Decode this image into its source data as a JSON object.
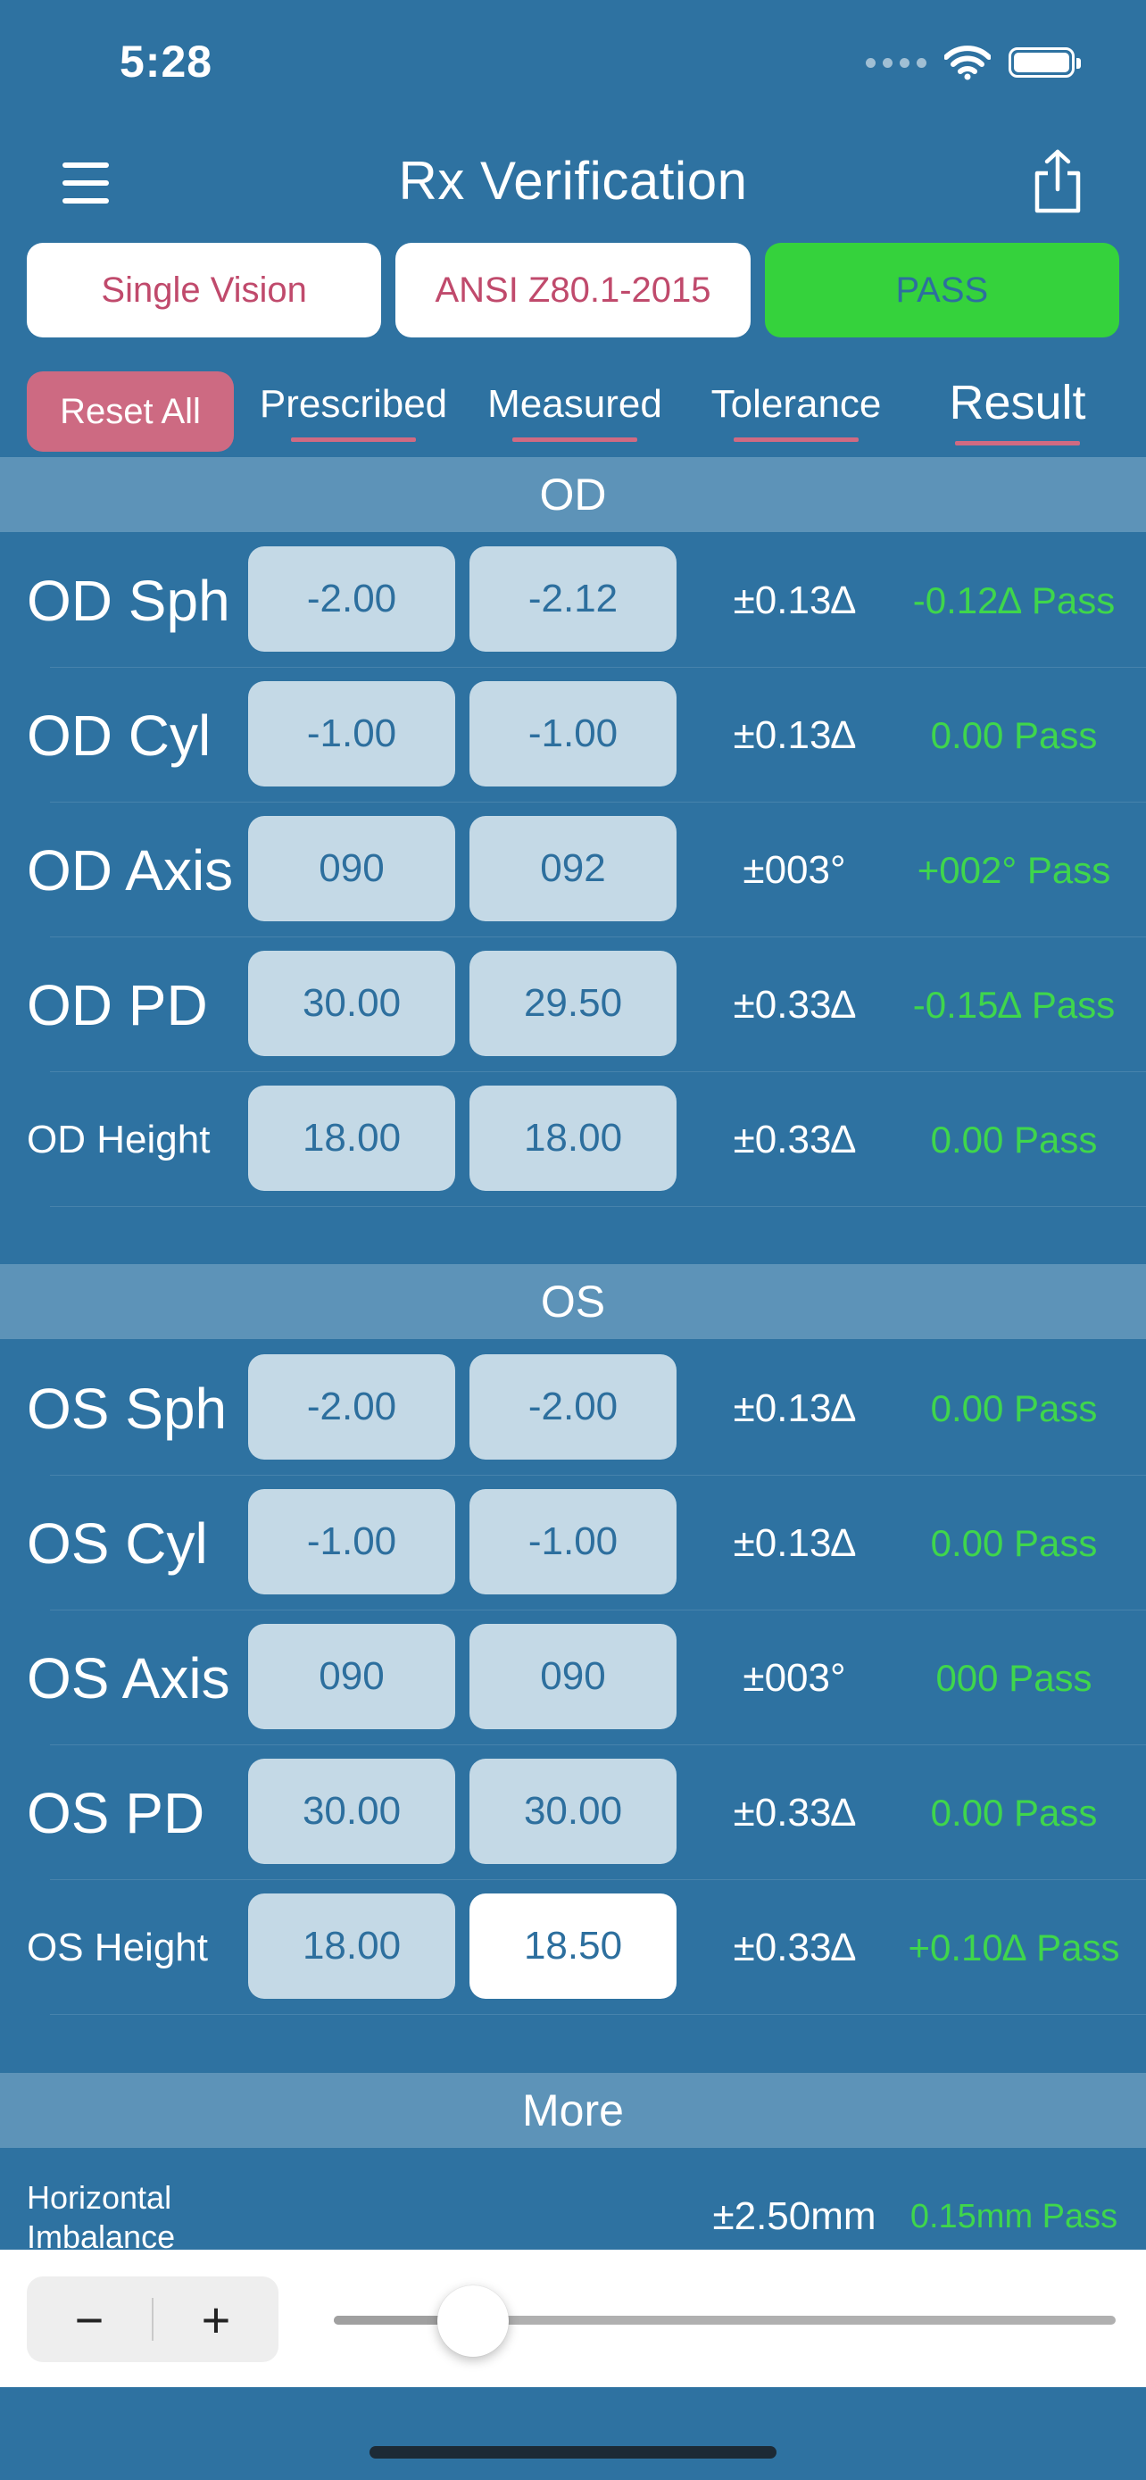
{
  "status": {
    "time": "5:28"
  },
  "nav": {
    "title": "Rx Verification"
  },
  "segments": {
    "lens_type": "Single Vision",
    "standard": "ANSI Z80.1-2015",
    "status": "PASS"
  },
  "headers": {
    "reset": "Reset All",
    "prescribed": "Prescribed",
    "measured": "Measured",
    "tolerance": "Tolerance",
    "result": "Result"
  },
  "od": {
    "title": "OD",
    "rows": [
      {
        "label": "OD Sph",
        "prescribed": "-2.00",
        "measured": "-2.12",
        "tolerance": "±0.13∆",
        "result": "-0.12∆ Pass"
      },
      {
        "label": "OD Cyl",
        "prescribed": "-1.00",
        "measured": "-1.00",
        "tolerance": "±0.13∆",
        "result": "0.00 Pass"
      },
      {
        "label": "OD Axis",
        "prescribed": "090",
        "measured": "092",
        "tolerance": "±003°",
        "result": "+002° Pass"
      },
      {
        "label": "OD PD",
        "prescribed": "30.00",
        "measured": "29.50",
        "tolerance": "±0.33∆",
        "result": "-0.15∆ Pass"
      },
      {
        "label": "OD Height",
        "prescribed": "18.00",
        "measured": "18.00",
        "tolerance": "±0.33∆",
        "result": "0.00 Pass"
      }
    ]
  },
  "os": {
    "title": "OS",
    "rows": [
      {
        "label": "OS Sph",
        "prescribed": "-2.00",
        "measured": "-2.00",
        "tolerance": "±0.13∆",
        "result": "0.00 Pass"
      },
      {
        "label": "OS Cyl",
        "prescribed": "-1.00",
        "measured": "-1.00",
        "tolerance": "±0.13∆",
        "result": "0.00 Pass"
      },
      {
        "label": "OS Axis",
        "prescribed": "090",
        "measured": "090",
        "tolerance": "±003°",
        "result": "000 Pass"
      },
      {
        "label": "OS PD",
        "prescribed": "30.00",
        "measured": "30.00",
        "tolerance": "±0.33∆",
        "result": "0.00 Pass"
      },
      {
        "label": "OS Height",
        "prescribed": "18.00",
        "measured": "18.50",
        "tolerance": "±0.33∆",
        "result": "+0.10∆ Pass"
      }
    ]
  },
  "more": {
    "title": "More",
    "row": {
      "label": "Horizontal Imbalance",
      "tolerance": "±2.50mm",
      "result": "0.15mm Pass"
    }
  },
  "bottom": {
    "minus": "−",
    "plus": "+",
    "slider_value": 0.178
  },
  "colors": {
    "background": "#2e72a1",
    "pass_green": "#3fd64c",
    "accent_pink": "#c04a6c",
    "cell": "#c4d9e6"
  }
}
